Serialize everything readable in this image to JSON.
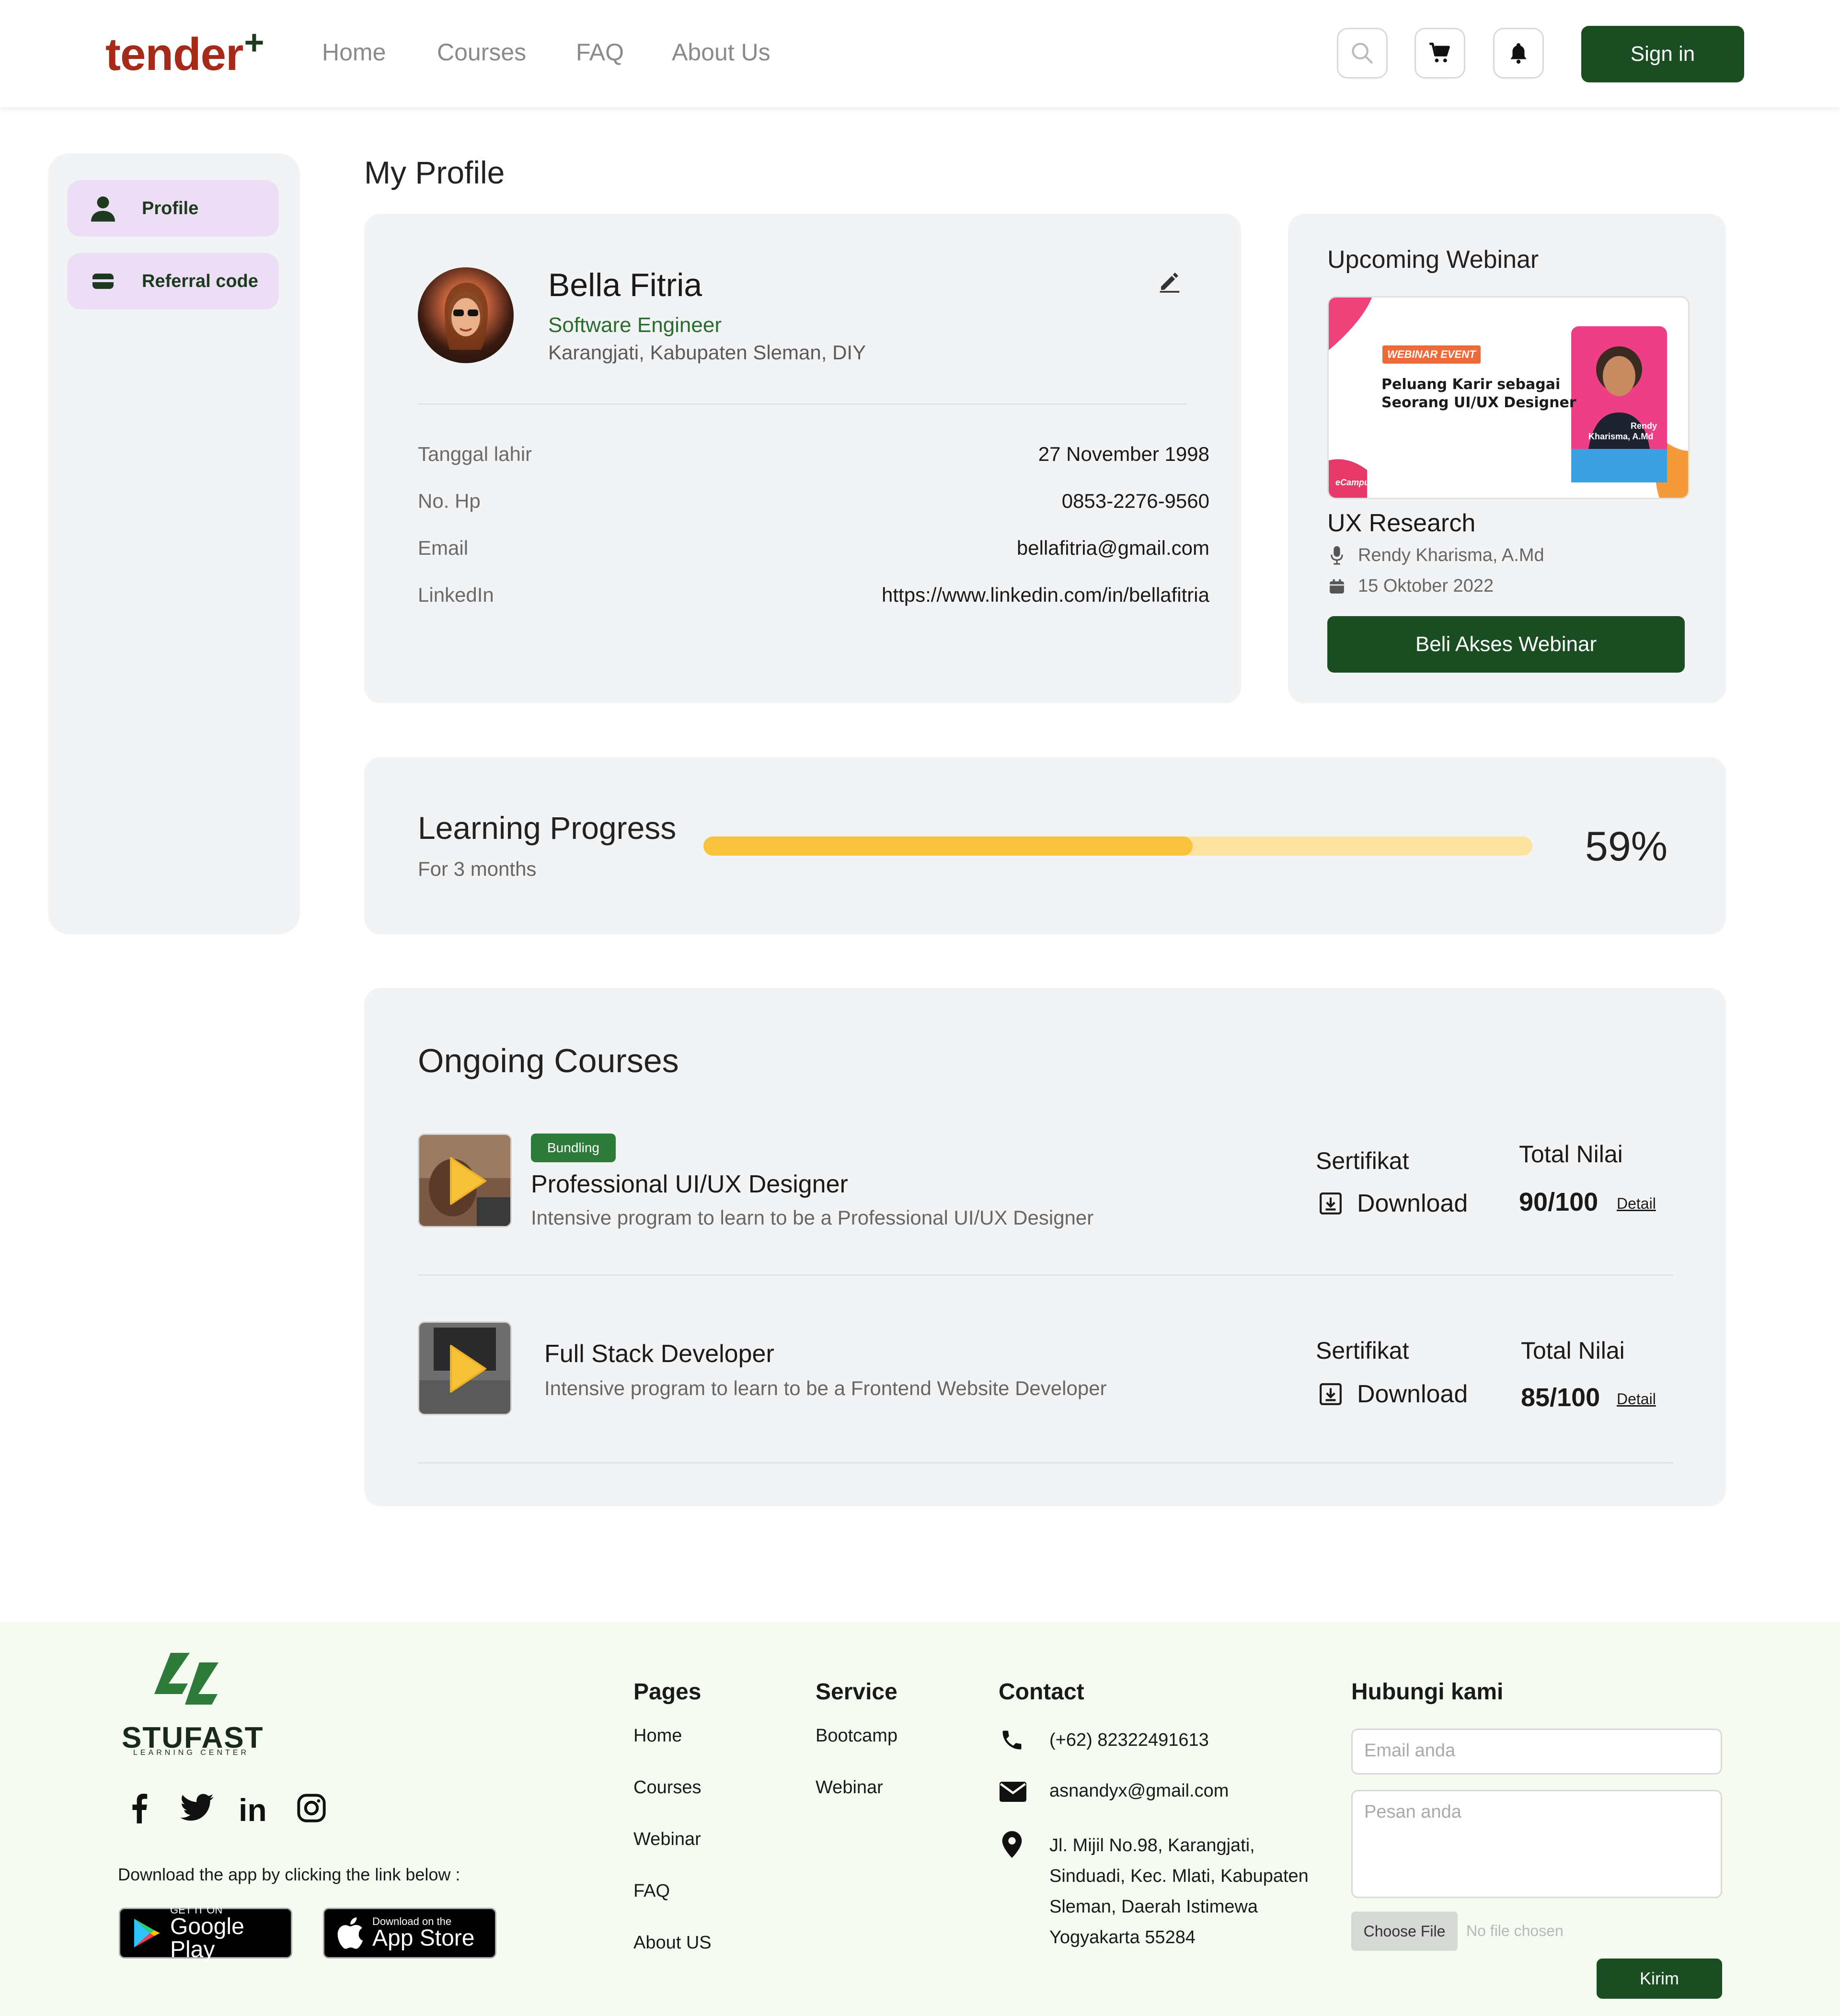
{
  "header": {
    "logo": "tender",
    "logo_mark": "+",
    "nav": [
      "Home",
      "Courses",
      "FAQ",
      "About Us"
    ],
    "icons": [
      "search-icon",
      "cart-icon",
      "bell-icon"
    ],
    "signin_label": "Sign in"
  },
  "sidebar": {
    "items": [
      {
        "label": "Profile",
        "icon": "user-icon"
      },
      {
        "label": "Referral code",
        "icon": "card-icon"
      }
    ]
  },
  "profile": {
    "page_title": "My Profile",
    "name": "Bella Fitria",
    "role": "Software Engineer",
    "location": "Karangjati, Kabupaten Sleman, DIY",
    "details": [
      {
        "label": "Tanggal lahir",
        "value": "27 November 1998"
      },
      {
        "label": "No. Hp",
        "value": "0853-2276-9560"
      },
      {
        "label": "Email",
        "value": "bellafitria@gmail.com"
      },
      {
        "label": "LinkedIn",
        "value": "https://www.linkedin.com/in/bellafitria"
      }
    ]
  },
  "webinar": {
    "section_title": "Upcoming Webinar",
    "banner": {
      "tag": "WEBINAR EVENT",
      "headline_1": "Peluang Karir sebagai",
      "headline_2": "Seorang UI/UX Designer",
      "speaker_1": "Rendy",
      "speaker_2": "Kharisma, A.Md",
      "brand": "eCampuz"
    },
    "name": "UX Research",
    "speaker": "Rendy Kharisma, A.Md",
    "date": "15 Oktober 2022",
    "button_label": "Beli Akses Webinar"
  },
  "progress": {
    "title": "Learning Progress",
    "subtitle": "For 3 months",
    "percent_label": "59%",
    "value": 0.59,
    "colors": {
      "fill": "#f9c23c",
      "track": "#fce3a0"
    }
  },
  "courses": {
    "section_title": "Ongoing Courses",
    "items": [
      {
        "badge": "Bundling",
        "name": "Professional UI/UX Designer",
        "desc": "Intensive program to learn to be a Professional UI/UX Designer",
        "cert_label": "Sertifikat",
        "download_label": "Download",
        "score_label": "Total Nilai",
        "score": "90/100",
        "detail_label": "Detail"
      },
      {
        "badge": "",
        "name": "Full Stack Developer",
        "desc": "Intensive program to learn to be a Frontend Website Developer",
        "cert_label": "Sertifikat",
        "download_label": "Download",
        "score_label": "Total Nilai",
        "score": "85/100",
        "detail_label": "Detail"
      }
    ]
  },
  "footer": {
    "brand": "STUFAST",
    "brand_sub": "LEARNING CENTER",
    "social_icons": [
      "facebook-icon",
      "twitter-icon",
      "linkedin-icon",
      "instagram-icon"
    ],
    "download_text": "Download the app by clicking the link below :",
    "google_play": {
      "small": "GET IT ON",
      "big": "Google Play"
    },
    "app_store": {
      "small": "Download on the",
      "big": "App Store"
    },
    "pages": {
      "title": "Pages",
      "links": [
        "Home",
        "Courses",
        "Webinar",
        "FAQ",
        "About US"
      ]
    },
    "service": {
      "title": "Service",
      "links": [
        "Bootcamp",
        "Webinar"
      ]
    },
    "contact": {
      "title": "Contact",
      "phone": "(+62) 82322491613",
      "email": "asnandyx@gmail.com",
      "address_1": "Jl. Mijil No.98, Karangjati,",
      "address_2": "Sinduadi, Kec. Mlati, Kabupaten",
      "address_3": "Sleman, Daerah Istimewa",
      "address_4": "Yogyakarta 55284"
    },
    "form": {
      "title": "Hubungi kami",
      "email_placeholder": "Email anda",
      "message_placeholder": "Pesan anda",
      "choose_file": "Choose File",
      "no_file": "No file chosen",
      "submit_label": "Kirim"
    }
  },
  "colors": {
    "primary": "#1b4d23",
    "logo": "#a52a1a",
    "accent_green": "#2a6b2e",
    "sidebar_item": "#ecdff5"
  }
}
